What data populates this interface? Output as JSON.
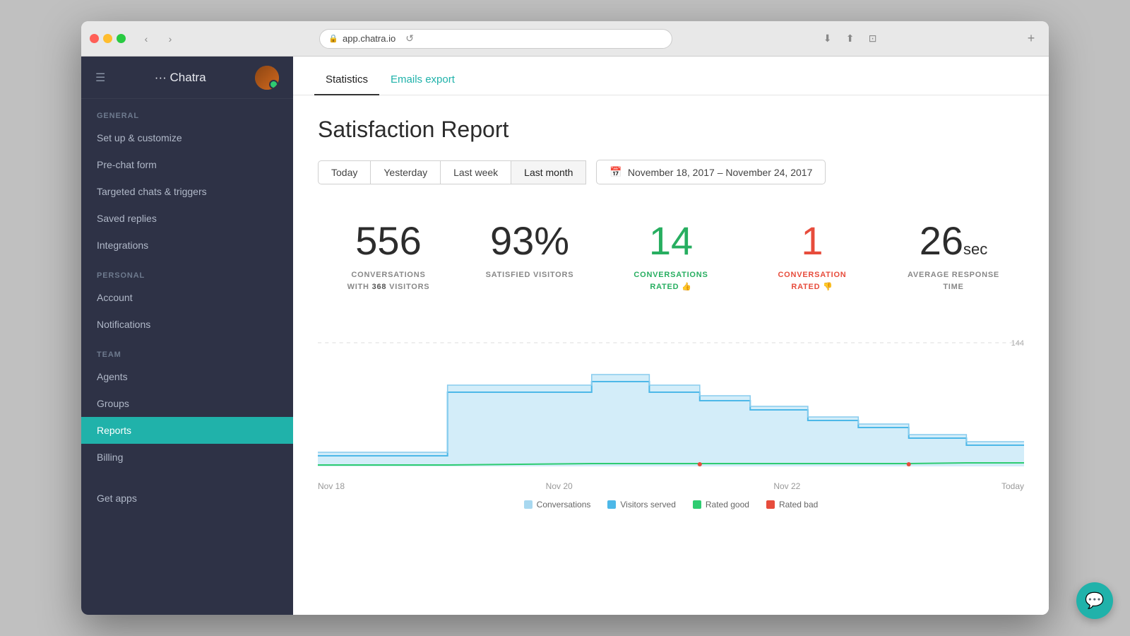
{
  "browser": {
    "url": "app.chatra.io",
    "back_label": "‹",
    "forward_label": "›",
    "reload_label": "↺",
    "add_tab_label": "+"
  },
  "sidebar": {
    "brand": "··· Chatra",
    "sections": [
      {
        "label": "GENERAL",
        "items": [
          {
            "id": "setup",
            "label": "Set up & customize",
            "active": false
          },
          {
            "id": "prechat",
            "label": "Pre-chat form",
            "active": false
          },
          {
            "id": "targeted",
            "label": "Targeted chats & triggers",
            "active": false
          },
          {
            "id": "saved",
            "label": "Saved replies",
            "active": false
          },
          {
            "id": "integrations",
            "label": "Integrations",
            "active": false
          }
        ]
      },
      {
        "label": "PERSONAL",
        "items": [
          {
            "id": "account",
            "label": "Account",
            "active": false
          },
          {
            "id": "notifications",
            "label": "Notifications",
            "active": false
          }
        ]
      },
      {
        "label": "TEAM",
        "items": [
          {
            "id": "agents",
            "label": "Agents",
            "active": false
          },
          {
            "id": "groups",
            "label": "Groups",
            "active": false
          },
          {
            "id": "reports",
            "label": "Reports",
            "active": true
          },
          {
            "id": "billing",
            "label": "Billing",
            "active": false
          }
        ]
      },
      {
        "label": "",
        "items": [
          {
            "id": "getapps",
            "label": "Get apps",
            "active": false
          }
        ]
      }
    ]
  },
  "tabs": [
    {
      "id": "statistics",
      "label": "Statistics",
      "active": true,
      "link_style": false
    },
    {
      "id": "emails_export",
      "label": "Emails export",
      "active": false,
      "link_style": true
    }
  ],
  "report": {
    "title": "Satisfaction Report",
    "date_filters": [
      {
        "id": "today",
        "label": "Today",
        "active": false
      },
      {
        "id": "yesterday",
        "label": "Yesterday",
        "active": false
      },
      {
        "id": "last_week",
        "label": "Last week",
        "active": false
      },
      {
        "id": "last_month",
        "label": "Last month",
        "active": true
      }
    ],
    "date_range": "November 18, 2017 – November 24, 2017",
    "stats": [
      {
        "id": "conversations",
        "value": "556",
        "unit": "",
        "color": "normal",
        "label_line1": "CONVERSATIONS",
        "label_line2": "WITH",
        "label_bold": "368",
        "label_line3": "VISITORS"
      },
      {
        "id": "satisfied",
        "value": "93%",
        "unit": "",
        "color": "normal",
        "label_line1": "SATISFIED VISITORS",
        "label_line2": "",
        "label_bold": "",
        "label_line3": ""
      },
      {
        "id": "rated_good",
        "value": "14",
        "unit": "",
        "color": "green",
        "label_line1": "CONVERSATIONS",
        "label_line2": "RATED 👍",
        "label_bold": "",
        "label_line3": ""
      },
      {
        "id": "rated_bad",
        "value": "1",
        "unit": "",
        "color": "red",
        "label_line1": "CONVERSATION",
        "label_line2": "RATED 👎",
        "label_bold": "",
        "label_line3": ""
      },
      {
        "id": "response_time",
        "value": "26",
        "unit": "sec",
        "color": "normal",
        "label_line1": "AVERAGE RESPONSE",
        "label_line2": "TIME",
        "label_bold": "",
        "label_line3": ""
      }
    ],
    "chart": {
      "y_max_label": "144",
      "x_labels": [
        "Nov 18",
        "Nov 20",
        "Nov 22",
        "Today"
      ]
    },
    "legend": [
      {
        "id": "conversations",
        "label": "Conversations",
        "color": "#a8d8f0"
      },
      {
        "id": "visitors_served",
        "label": "Visitors served",
        "color": "#4db8e8"
      },
      {
        "id": "rated_good",
        "label": "Rated good",
        "color": "#2ecc71"
      },
      {
        "id": "rated_bad",
        "label": "Rated bad",
        "color": "#e74c3c"
      }
    ]
  },
  "chat_widget": {
    "icon": "💬"
  }
}
